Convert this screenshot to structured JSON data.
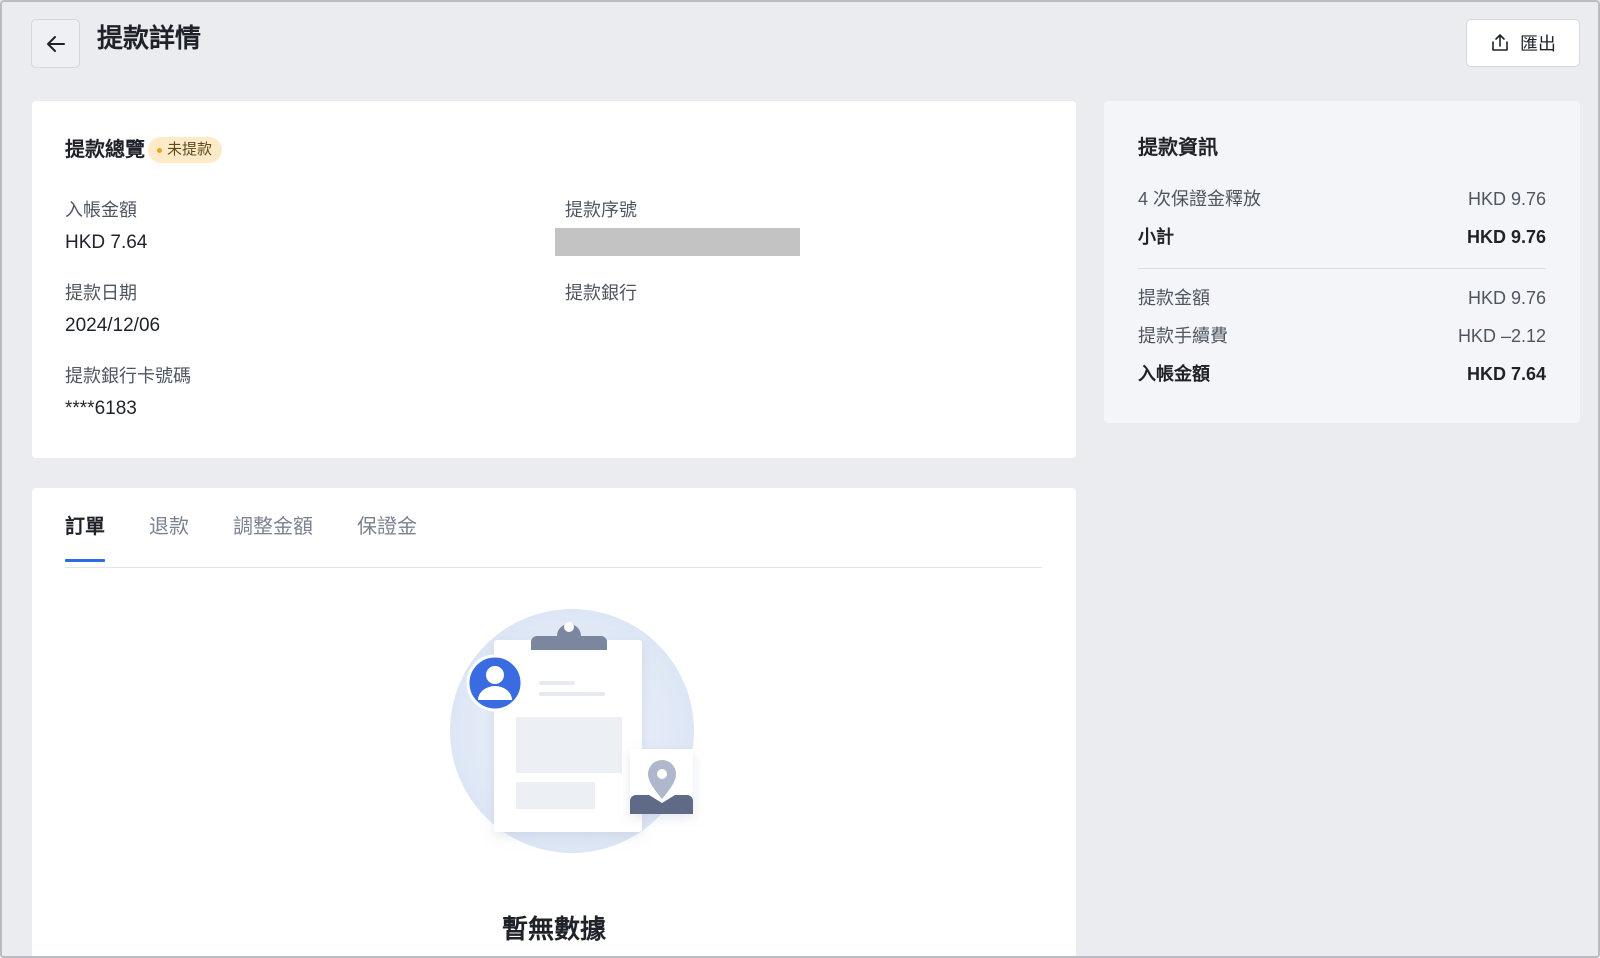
{
  "header": {
    "title": "提款詳情",
    "export_label": "匯出"
  },
  "overview": {
    "title": "提款總覽",
    "status_badge": "未提款",
    "fields": {
      "credited_amount": {
        "label": "入帳金額",
        "value": "HKD 7.64"
      },
      "withdrawal_no": {
        "label": "提款序號",
        "value": ""
      },
      "withdrawal_date": {
        "label": "提款日期",
        "value": "2024/12/06"
      },
      "withdrawal_bank": {
        "label": "提款銀行",
        "value": ""
      },
      "bank_card_no": {
        "label": "提款銀行卡號碼",
        "value": "****6183"
      }
    }
  },
  "info": {
    "title": "提款資訊",
    "rows": [
      {
        "label": "4 次保證金釋放",
        "value": "HKD 9.76"
      },
      {
        "label": "小計",
        "value": "HKD 9.76"
      },
      {
        "label": "提款金額",
        "value": "HKD 9.76"
      },
      {
        "label": "提款手續費",
        "value": "HKD –2.12"
      },
      {
        "label": "入帳金額",
        "value": "HKD 7.64"
      }
    ]
  },
  "tabs": [
    {
      "label": "訂單",
      "active": true
    },
    {
      "label": "退款",
      "active": false
    },
    {
      "label": "調整金額",
      "active": false
    },
    {
      "label": "保證金",
      "active": false
    }
  ],
  "empty_state": {
    "text": "暫無數據"
  },
  "colors": {
    "accent": "#2b6be6",
    "badge_bg": "#fdebc8",
    "badge_dot": "#f0a020",
    "page_bg": "#ebecf0"
  },
  "icons": [
    "arrow-left-icon",
    "export-icon",
    "clipboard-empty-illustration"
  ]
}
